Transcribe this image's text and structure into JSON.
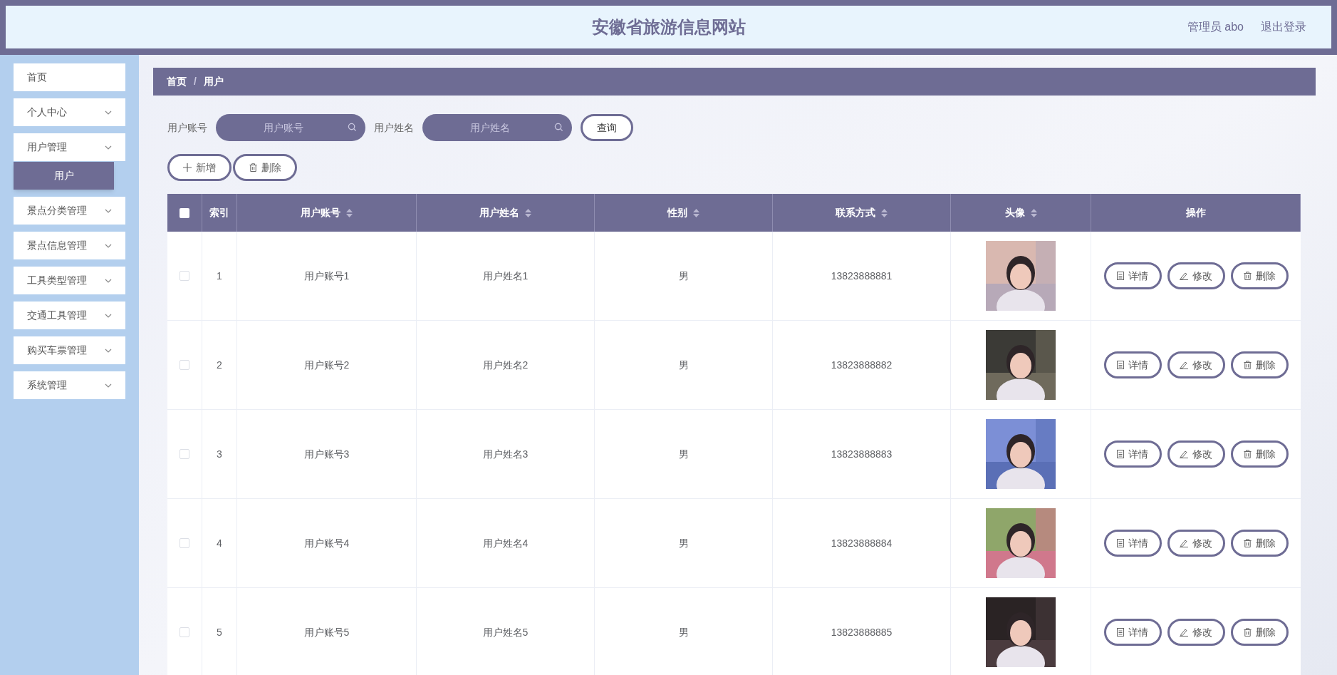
{
  "header": {
    "title": "安徽省旅游信息网站",
    "user": "管理员 abo",
    "logout": "退出登录"
  },
  "sidebar": {
    "items": [
      {
        "label": "首页",
        "expandable": false,
        "selected": false
      },
      {
        "label": "个人中心",
        "expandable": true,
        "selected": false
      },
      {
        "label": "用户管理",
        "expandable": true,
        "selected": false,
        "children": [
          {
            "label": "用户",
            "selected": true
          }
        ]
      },
      {
        "label": "景点分类管理",
        "expandable": true,
        "selected": false
      },
      {
        "label": "景点信息管理",
        "expandable": true,
        "selected": false
      },
      {
        "label": "工具类型管理",
        "expandable": true,
        "selected": false
      },
      {
        "label": "交通工具管理",
        "expandable": true,
        "selected": false
      },
      {
        "label": "购买车票管理",
        "expandable": true,
        "selected": false
      },
      {
        "label": "系统管理",
        "expandable": true,
        "selected": false
      }
    ]
  },
  "breadcrumb": {
    "items": [
      "首页",
      "用户"
    ],
    "separator": "/"
  },
  "search": {
    "fields": [
      {
        "label": "用户账号",
        "placeholder": "用户账号"
      },
      {
        "label": "用户姓名",
        "placeholder": "用户姓名"
      }
    ],
    "button": "查询"
  },
  "actions": [
    {
      "kind": "add",
      "label": "新增"
    },
    {
      "kind": "delete",
      "label": "删除"
    }
  ],
  "table": {
    "select_all": {
      "checked": false
    },
    "columns": [
      {
        "label": "索引",
        "sortable": false
      },
      {
        "label": "用户账号",
        "sortable": true
      },
      {
        "label": "用户姓名",
        "sortable": true
      },
      {
        "label": "性别",
        "sortable": true
      },
      {
        "label": "联系方式",
        "sortable": true
      },
      {
        "label": "头像",
        "sortable": true
      },
      {
        "label": "操作",
        "sortable": false
      }
    ],
    "rows": [
      {
        "checked": false,
        "index": "1",
        "account": "用户账号1",
        "name": "用户姓名1",
        "gender": "男",
        "phone": "13823888881",
        "actions": [
          {
            "kind": "detail",
            "label": "详情"
          },
          {
            "kind": "edit",
            "label": "修改"
          },
          {
            "kind": "delete",
            "label": "删除"
          }
        ]
      },
      {
        "checked": false,
        "index": "2",
        "account": "用户账号2",
        "name": "用户姓名2",
        "gender": "男",
        "phone": "13823888882",
        "actions": [
          {
            "kind": "detail",
            "label": "详情"
          },
          {
            "kind": "edit",
            "label": "修改"
          },
          {
            "kind": "delete",
            "label": "删除"
          }
        ]
      },
      {
        "checked": false,
        "index": "3",
        "account": "用户账号3",
        "name": "用户姓名3",
        "gender": "男",
        "phone": "13823888883",
        "actions": [
          {
            "kind": "detail",
            "label": "详情"
          },
          {
            "kind": "edit",
            "label": "修改"
          },
          {
            "kind": "delete",
            "label": "删除"
          }
        ]
      },
      {
        "checked": false,
        "index": "4",
        "account": "用户账号4",
        "name": "用户姓名4",
        "gender": "男",
        "phone": "13823888884",
        "actions": [
          {
            "kind": "detail",
            "label": "详情"
          },
          {
            "kind": "edit",
            "label": "修改"
          },
          {
            "kind": "delete",
            "label": "删除"
          }
        ]
      },
      {
        "checked": false,
        "index": "5",
        "account": "用户账号5",
        "name": "用户姓名5",
        "gender": "男",
        "phone": "13823888885",
        "actions": [
          {
            "kind": "detail",
            "label": "详情"
          },
          {
            "kind": "edit",
            "label": "修改"
          },
          {
            "kind": "delete",
            "label": "删除"
          }
        ]
      }
    ]
  }
}
